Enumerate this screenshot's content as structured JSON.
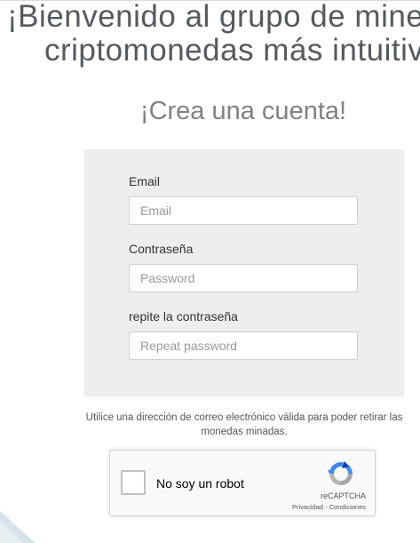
{
  "hero": {
    "line1": "¡Bienvenido al grupo de minerí",
    "line2": "criptomonedas más intuitiv"
  },
  "subtitle": "¡Crea una cuenta!",
  "form": {
    "email_label": "Email",
    "email_placeholder": "Email",
    "email_value": "",
    "password_label": "Contraseña",
    "password_placeholder": "Password",
    "password_value": "",
    "repeat_label": "repite la contraseña",
    "repeat_placeholder": "Repeat password",
    "repeat_value": ""
  },
  "notice": "Utilice una dirección de correo electrónico válida para poder retirar las monedas minadas.",
  "recaptcha": {
    "label": "No soy un robot",
    "brand": "reCAPTCHA",
    "privacy": "Privacidad",
    "separator": " - ",
    "terms": "Condiciones",
    "checked": false
  },
  "colors": {
    "heading": "#555a60",
    "panel": "#eeeeee",
    "recaptcha_blue": "#4a90e2",
    "recaptcha_gray": "#a6a6a6"
  }
}
